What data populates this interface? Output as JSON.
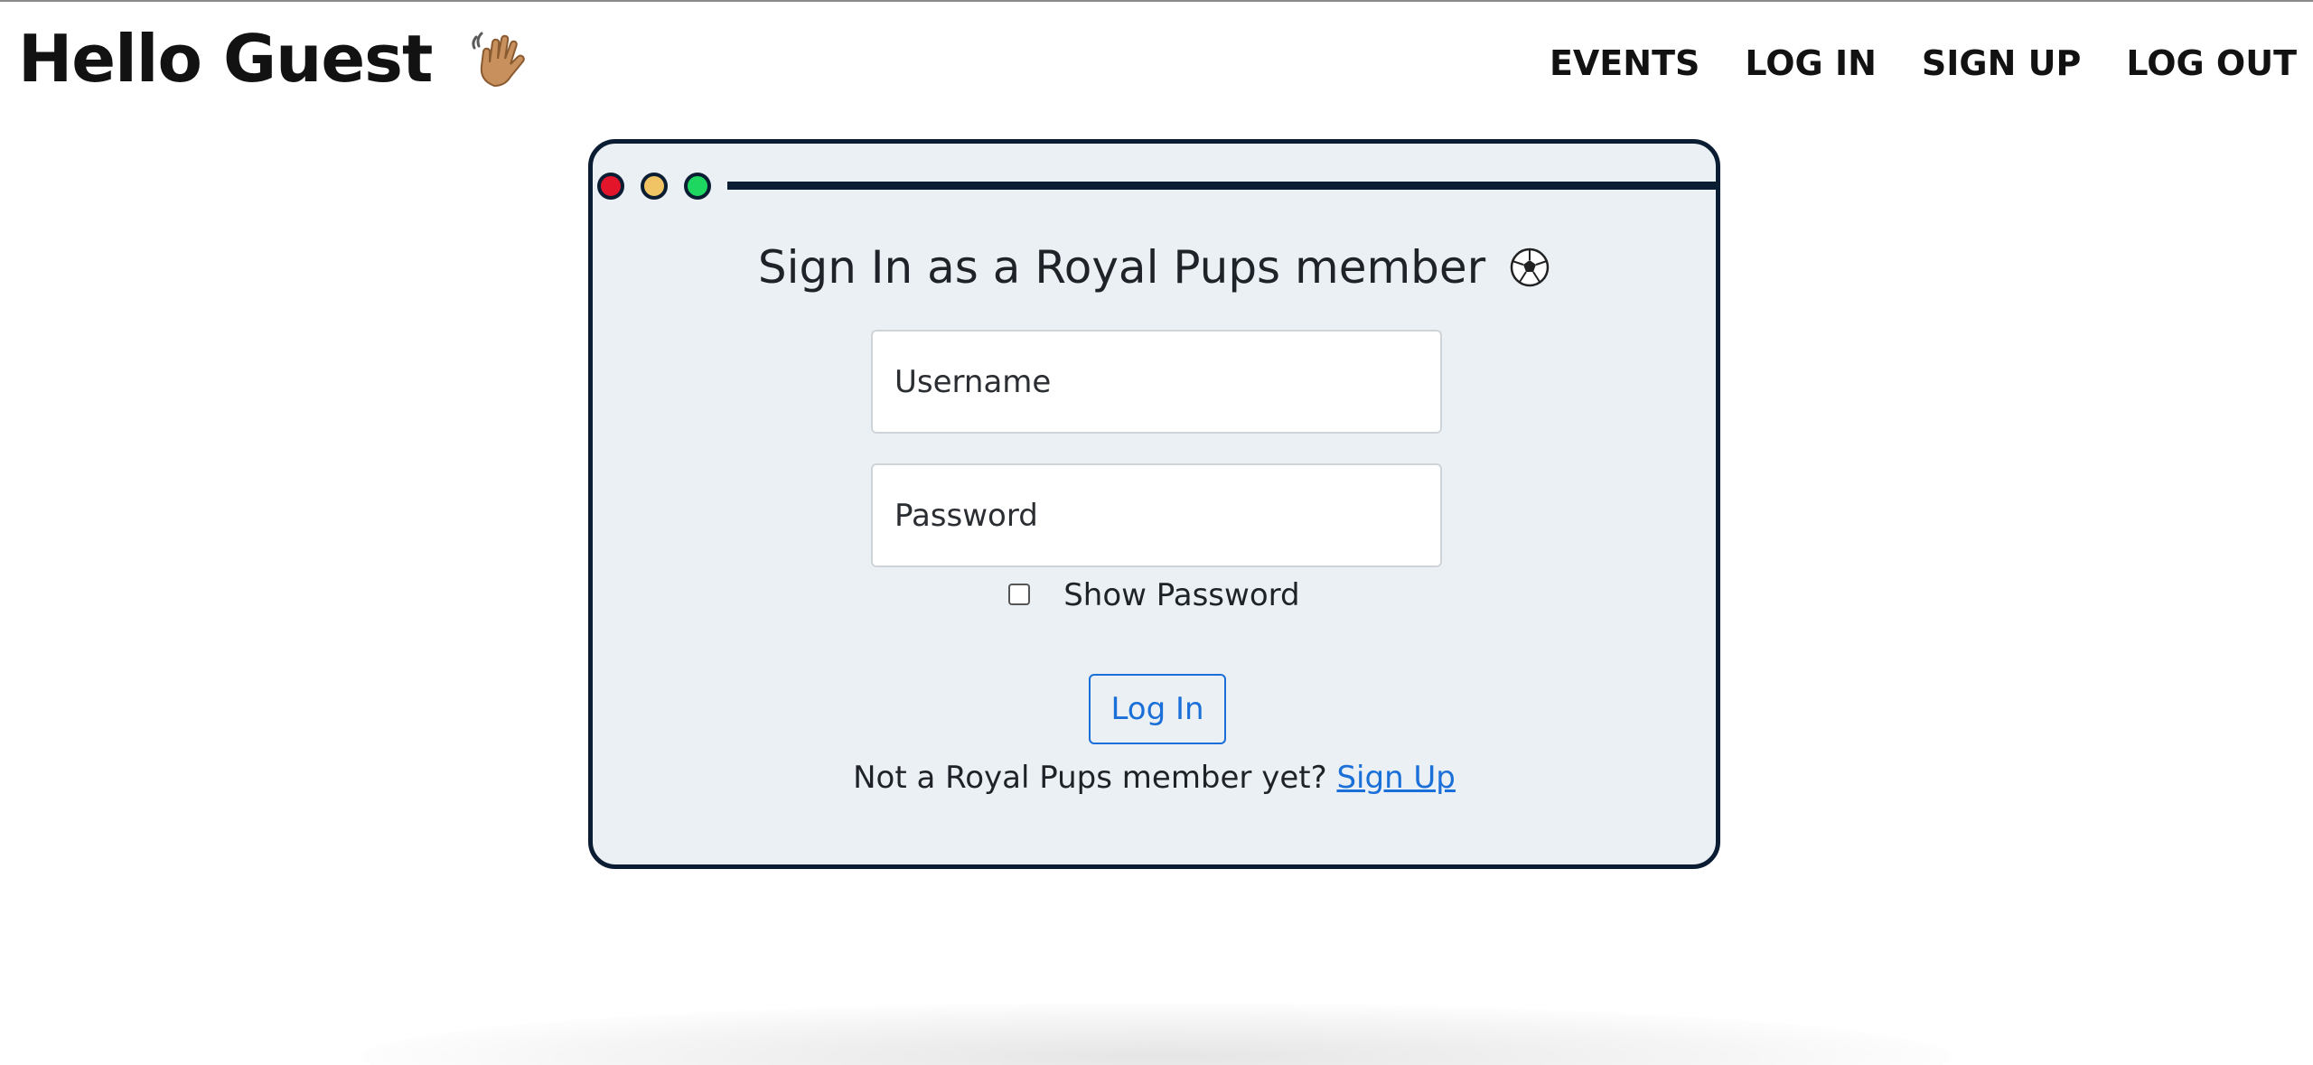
{
  "header": {
    "greeting": "Hello Guest",
    "greeting_icon": "waving-hand-icon",
    "nav": {
      "events": "EVENTS",
      "login": "LOG IN",
      "signup": "SIGN UP",
      "logout": "LOG OUT"
    }
  },
  "login_window": {
    "window_controls": [
      "close-dot",
      "minimize-dot",
      "maximize-dot"
    ],
    "title": "Sign In as a Royal Pups member",
    "title_icon": "soccer-ball-icon",
    "username": {
      "placeholder": "Username",
      "value": ""
    },
    "password": {
      "placeholder": "Password",
      "value": ""
    },
    "show_password": {
      "label": "Show Password",
      "checked": false
    },
    "submit_label": "Log In",
    "signup_prompt": "Not a Royal Pups member yet?",
    "signup_link": "Sign Up"
  },
  "colors": {
    "window_border": "#0b1d33",
    "window_background": "#eaf0f3",
    "accent_link": "#1a6fd8",
    "dot_red": "#e3152a",
    "dot_yellow": "#f0c464",
    "dot_green": "#1ed760"
  }
}
